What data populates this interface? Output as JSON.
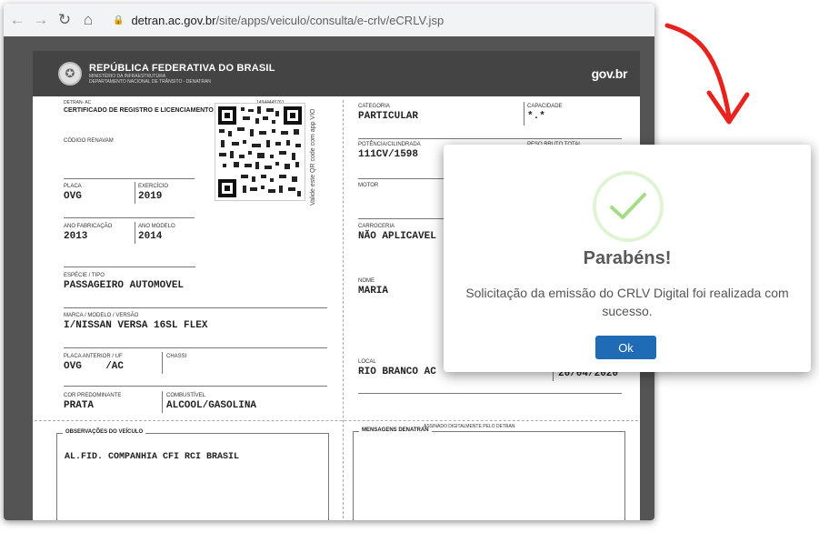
{
  "browser": {
    "url_host": "detran.ac.gov.br",
    "url_path": "/site/apps/veiculo/consulta/e-crlv/eCRLV.jsp"
  },
  "document": {
    "header": {
      "title": "REPÚBLICA FEDERATIVA DO BRASIL",
      "line1": "MINISTÉRIO DA INFRAESTRUTURA",
      "line2": "DEPARTAMENTO NACIONAL DE TRÂNSITO - DENATRAN",
      "brand": "gov.br"
    },
    "detran": "DETRAN- AC",
    "doc_number": "14944445761",
    "cert_title": "CERTIFICADO DE REGISTRO E LICENCIAMENTO DE VEÍCULO - ELETRÔNICO",
    "qr_caption": "Valide este QR code com app VIO",
    "fields": {
      "renavam": {
        "label": "CÓDIGO RENAVAM",
        "value": ""
      },
      "placa": {
        "label": "PLACA",
        "value": "OVG"
      },
      "exercicio": {
        "label": "EXERCÍCIO",
        "value": "2019"
      },
      "ano_fab": {
        "label": "ANO FABRICAÇÃO",
        "value": "2013"
      },
      "ano_mod": {
        "label": "ANO MODELO",
        "value": "2014"
      },
      "especie": {
        "label": "ESPÉCIE / TIPO",
        "value": "PASSAGEIRO AUTOMOVEL"
      },
      "marca": {
        "label": "MARCA / MODELO / VERSÃO",
        "value": "I/NISSAN VERSA 16SL FLEX"
      },
      "placa_ant": {
        "label": "PLACA ANTERIOR / UF",
        "value": "OVG    /AC"
      },
      "chassi": {
        "label": "CHASSI",
        "value": ""
      },
      "cor": {
        "label": "COR PREDOMINANTE",
        "value": "PRATA"
      },
      "combustivel": {
        "label": "COMBUSTÍVEL",
        "value": "ALCOOL/GASOLINA"
      },
      "categoria": {
        "label": "CATEGORIA",
        "value": "PARTICULAR"
      },
      "capacidade": {
        "label": "CAPACIDADE",
        "value": "*.*"
      },
      "potencia": {
        "label": "POTÊNCIA/CILINDRADA",
        "value": "111CV/1598"
      },
      "peso": {
        "label": "PESO BRUTO TOTAL",
        "value": ""
      },
      "motor": {
        "label": "MOTOR",
        "value": ""
      },
      "carroceria": {
        "label": "CARROCERIA",
        "value": "NÃO APLICAVEL"
      },
      "nome": {
        "label": "NOME",
        "value": "MARIA"
      },
      "local": {
        "label": "LOCAL",
        "value": "RIO BRANCO AC"
      },
      "data": {
        "label": "",
        "value": "20/04/2020"
      }
    },
    "signed": "ASSINADO DIGITALMENTE PELO DETRAN",
    "obs_title": "OBSERVAÇÕES DO VEÍCULO",
    "obs_value": "AL.FID. COMPANHIA CFI RCI BRASIL",
    "msgs_title": "MENSAGENS DENATRAN"
  },
  "modal": {
    "title": "Parabéns!",
    "message": "Solicitação da emissão do CRLV Digital foi realizada com sucesso.",
    "ok_label": "Ok"
  },
  "colors": {
    "arrow": "#e8231d",
    "check": "#a5dc86",
    "ok_button": "#1f6bb5"
  }
}
